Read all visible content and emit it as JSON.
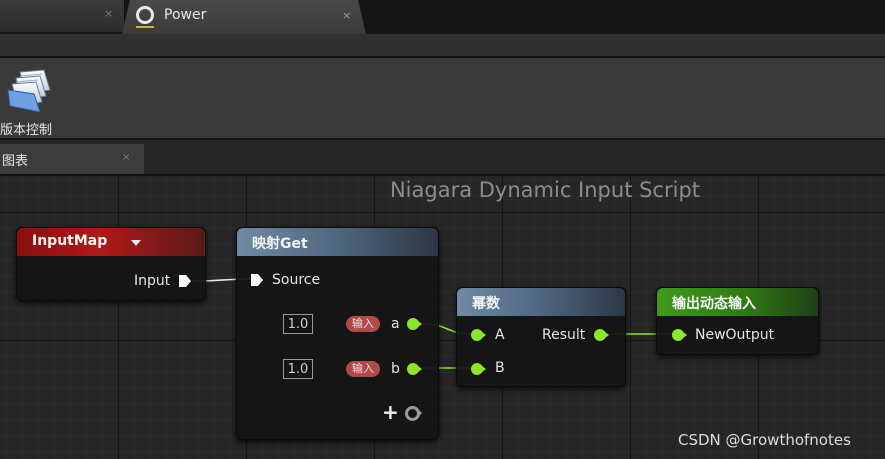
{
  "tabs": {
    "active_title": "Power",
    "close_glyph": "×"
  },
  "toolbar": {
    "version_control_label": "版本控制"
  },
  "graph_tab": {
    "label": "图表"
  },
  "graph": {
    "title": "Niagara Dynamic Input Script"
  },
  "nodes": {
    "input_map": {
      "title": "InputMap",
      "output_pin": "Input"
    },
    "map_get": {
      "title": "映射Get",
      "source_pin": "Source",
      "param_a": {
        "value": "1.0",
        "badge": "输入",
        "name": "a"
      },
      "param_b": {
        "value": "1.0",
        "badge": "输入",
        "name": "b"
      },
      "add_pin": "+"
    },
    "power": {
      "title": "幂数",
      "input_a": "A",
      "input_b": "B",
      "output": "Result"
    },
    "output": {
      "title": "输出动态输入",
      "input": "NewOutput"
    }
  },
  "colors": {
    "float_pin": "#8ce62a",
    "map_pin": "#ffffff",
    "header_red": "#b01818",
    "header_blue": "#4f6680",
    "header_green": "#2f7a12"
  },
  "icons": [
    "circle-ring-icon",
    "version-control-icon",
    "close-icon",
    "dropdown-caret-icon",
    "exec-pin-icon",
    "float-pin-icon",
    "add-pin-icon"
  ],
  "watermark": "CSDN @Growthofnotes"
}
